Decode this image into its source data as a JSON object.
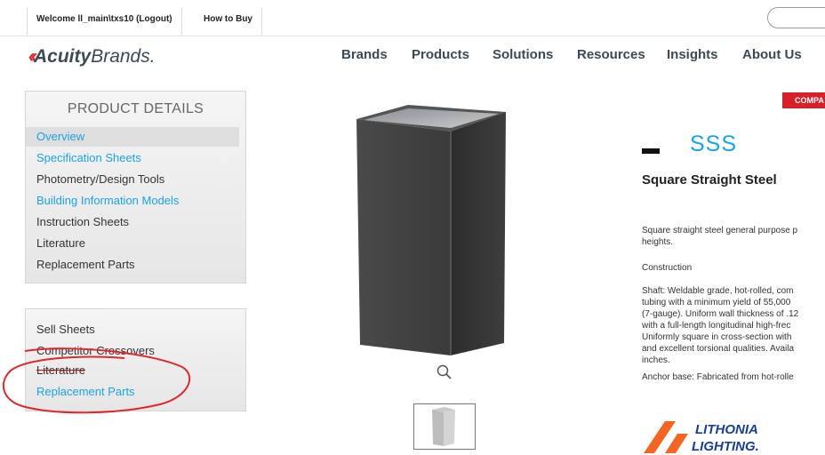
{
  "topbar": {
    "welcome_label": "Welcome ll_main\\txs10 (Logout)",
    "how_to_buy_label": "How to Buy"
  },
  "brand": {
    "logo_mark": "‹‹",
    "logo_word1": "Acuity",
    "logo_word2": "Brands."
  },
  "nav": {
    "items": [
      "Brands",
      "Products",
      "Solutions",
      "Resources",
      "Insights",
      "About Us"
    ]
  },
  "product_details_panel": {
    "title": "PRODUCT DETAILS",
    "links": [
      "Overview",
      "Specification Sheets",
      "Photometry/Design Tools",
      "Building Information Models",
      "Instruction Sheets",
      "Literature",
      "Replacement Parts"
    ]
  },
  "sales_panel": {
    "links": [
      "Sell Sheets",
      "Competitor Crossovers",
      "Literature",
      "Replacement Parts"
    ]
  },
  "product": {
    "compare_label": "COMPA",
    "sku": "SSS",
    "name": "Square Straight Steel",
    "description_lines": [
      "Square straight steel general purpose p",
      "heights."
    ],
    "construction_heading": "Construction",
    "shaft_lines": [
      "Shaft: Weldable grade, hot-rolled, com",
      "tubing with a minimum yield of 55,000",
      "(7-gauge). Uniform wall thickness of .12",
      "with a full-length longitudinal high-frec",
      "Uniformly square in cross-section with",
      "and excellent torsional qualities. Availa",
      "inches."
    ],
    "anchor_line": "Anchor base: Fabricated from hot-rolle"
  },
  "manufacturer": {
    "line1": "LITHONIA",
    "line2": "LIGHTING."
  },
  "icons": {
    "zoom": "magnifier-icon",
    "search": "search-field"
  },
  "colors": {
    "link_blue": "#1aa3e6",
    "accent_red": "#d8202a",
    "lithonia_orange": "#f26522",
    "lithonia_blue": "#1b3f8f"
  }
}
